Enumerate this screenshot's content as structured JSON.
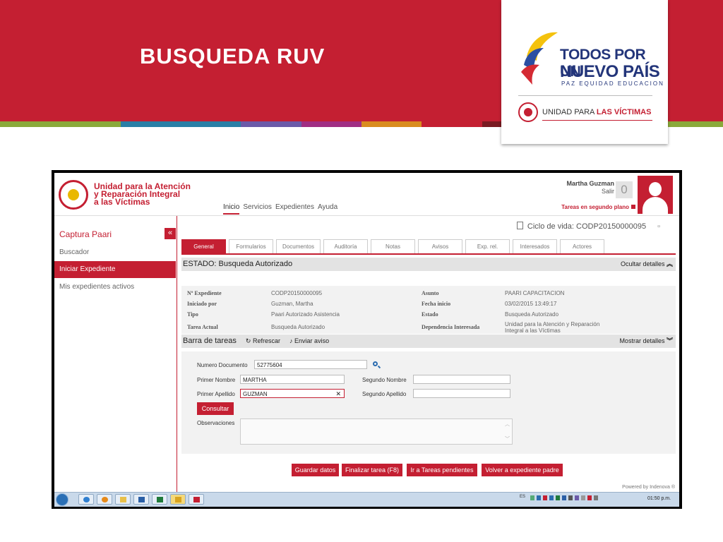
{
  "slide": {
    "title": "BUSQUEDA RUV",
    "colors": {
      "brand_red": "#c41f32",
      "strip": [
        "#8aa93a",
        "#8aa93a",
        "#2a7fa6",
        "#2a7fa6",
        "#6b5aa8",
        "#a02e83",
        "#d98c1f",
        "#c41f32",
        "#7a1a22",
        "#d9a41f",
        "#b41f52",
        "#8aa93a"
      ]
    },
    "logo": {
      "line1": "TODOS POR UN",
      "line2": "NUEVO PAÍS",
      "tagline": "PAZ  EQUIDAD  EDUCACION",
      "unit_prefix": "UNIDAD PARA ",
      "unit_suffix": "LAS VÍCTIMAS"
    }
  },
  "app": {
    "entity": {
      "line1": "Unidad para la Atención",
      "line2": "y Reparación Integral",
      "line3": "a las Víctimas"
    },
    "nav": [
      "Inicio",
      "Servicios",
      "Expedientes",
      "Ayuda"
    ],
    "user": {
      "name": "Martha Guzman",
      "exit": "Salir",
      "notifications": "0",
      "background_tasks": "Tareas en segundo plano"
    },
    "sidebar": {
      "title": "Captura Paari",
      "collapse": "«",
      "items": [
        {
          "label": "Buscador"
        },
        {
          "label": "Iniciar Expediente"
        },
        {
          "label": "Mis expedientes activos"
        }
      ]
    },
    "lifecycle": "Ciclo de vida: CODP20150000095",
    "tabs": [
      "General",
      "Formularios",
      "Documentos",
      "Auditoría",
      "Notas",
      "Avisos",
      "Exp. rel.",
      "Interesados",
      "Actores"
    ],
    "status": {
      "title": "ESTADO: Busqueda Autorizado",
      "toggle": "Ocultar detalles"
    },
    "details": {
      "left": [
        {
          "label": "Nº Expediente",
          "value": "CODP20150000095"
        },
        {
          "label": "Iniciado por",
          "value": "Guzman, Martha"
        },
        {
          "label": "Tipo",
          "value": "Paari Autorizado Asistencia"
        },
        {
          "label": "Tarea Actual",
          "value": "Busqueda Autorizado"
        }
      ],
      "right": [
        {
          "label": "Asunto",
          "value": "PAARI CAPACITACION"
        },
        {
          "label": "Fecha inicio",
          "value": "03/02/2015 13:49:17"
        },
        {
          "label": "Estado",
          "value": "Busqueda Autorizado"
        },
        {
          "label": "Dependencia Interesada",
          "value": "Unidad para la Atención y Reparación Integral a las Víctimas"
        }
      ]
    },
    "taskbar_section": {
      "title": "Barra de tareas",
      "refresh": "Refrescar",
      "notify": "Enviar aviso",
      "toggle": "Mostrar detalles"
    },
    "form": {
      "doc_label": "Numero Documento",
      "doc_value": "52775604",
      "first_name_label": "Primer Nombre",
      "first_name_value": "MARTHA",
      "second_name_label": "Segundo Nombre",
      "second_name_value": "",
      "first_surname_label": "Primer Apellido",
      "first_surname_value": "GUZMAN",
      "second_surname_label": "Segundo Apellido",
      "second_surname_value": "",
      "consult": "Consultar",
      "obs_label": "Observaciones"
    },
    "actions": [
      "Guardar datos",
      "Finalizar tarea (F8)",
      "Ir a Tareas pendientes",
      "Volver a expediente padre"
    ],
    "powered": "Powered by Indenova ®"
  },
  "os_taskbar": {
    "lang": "ES",
    "clock": "01:50 p.m."
  }
}
